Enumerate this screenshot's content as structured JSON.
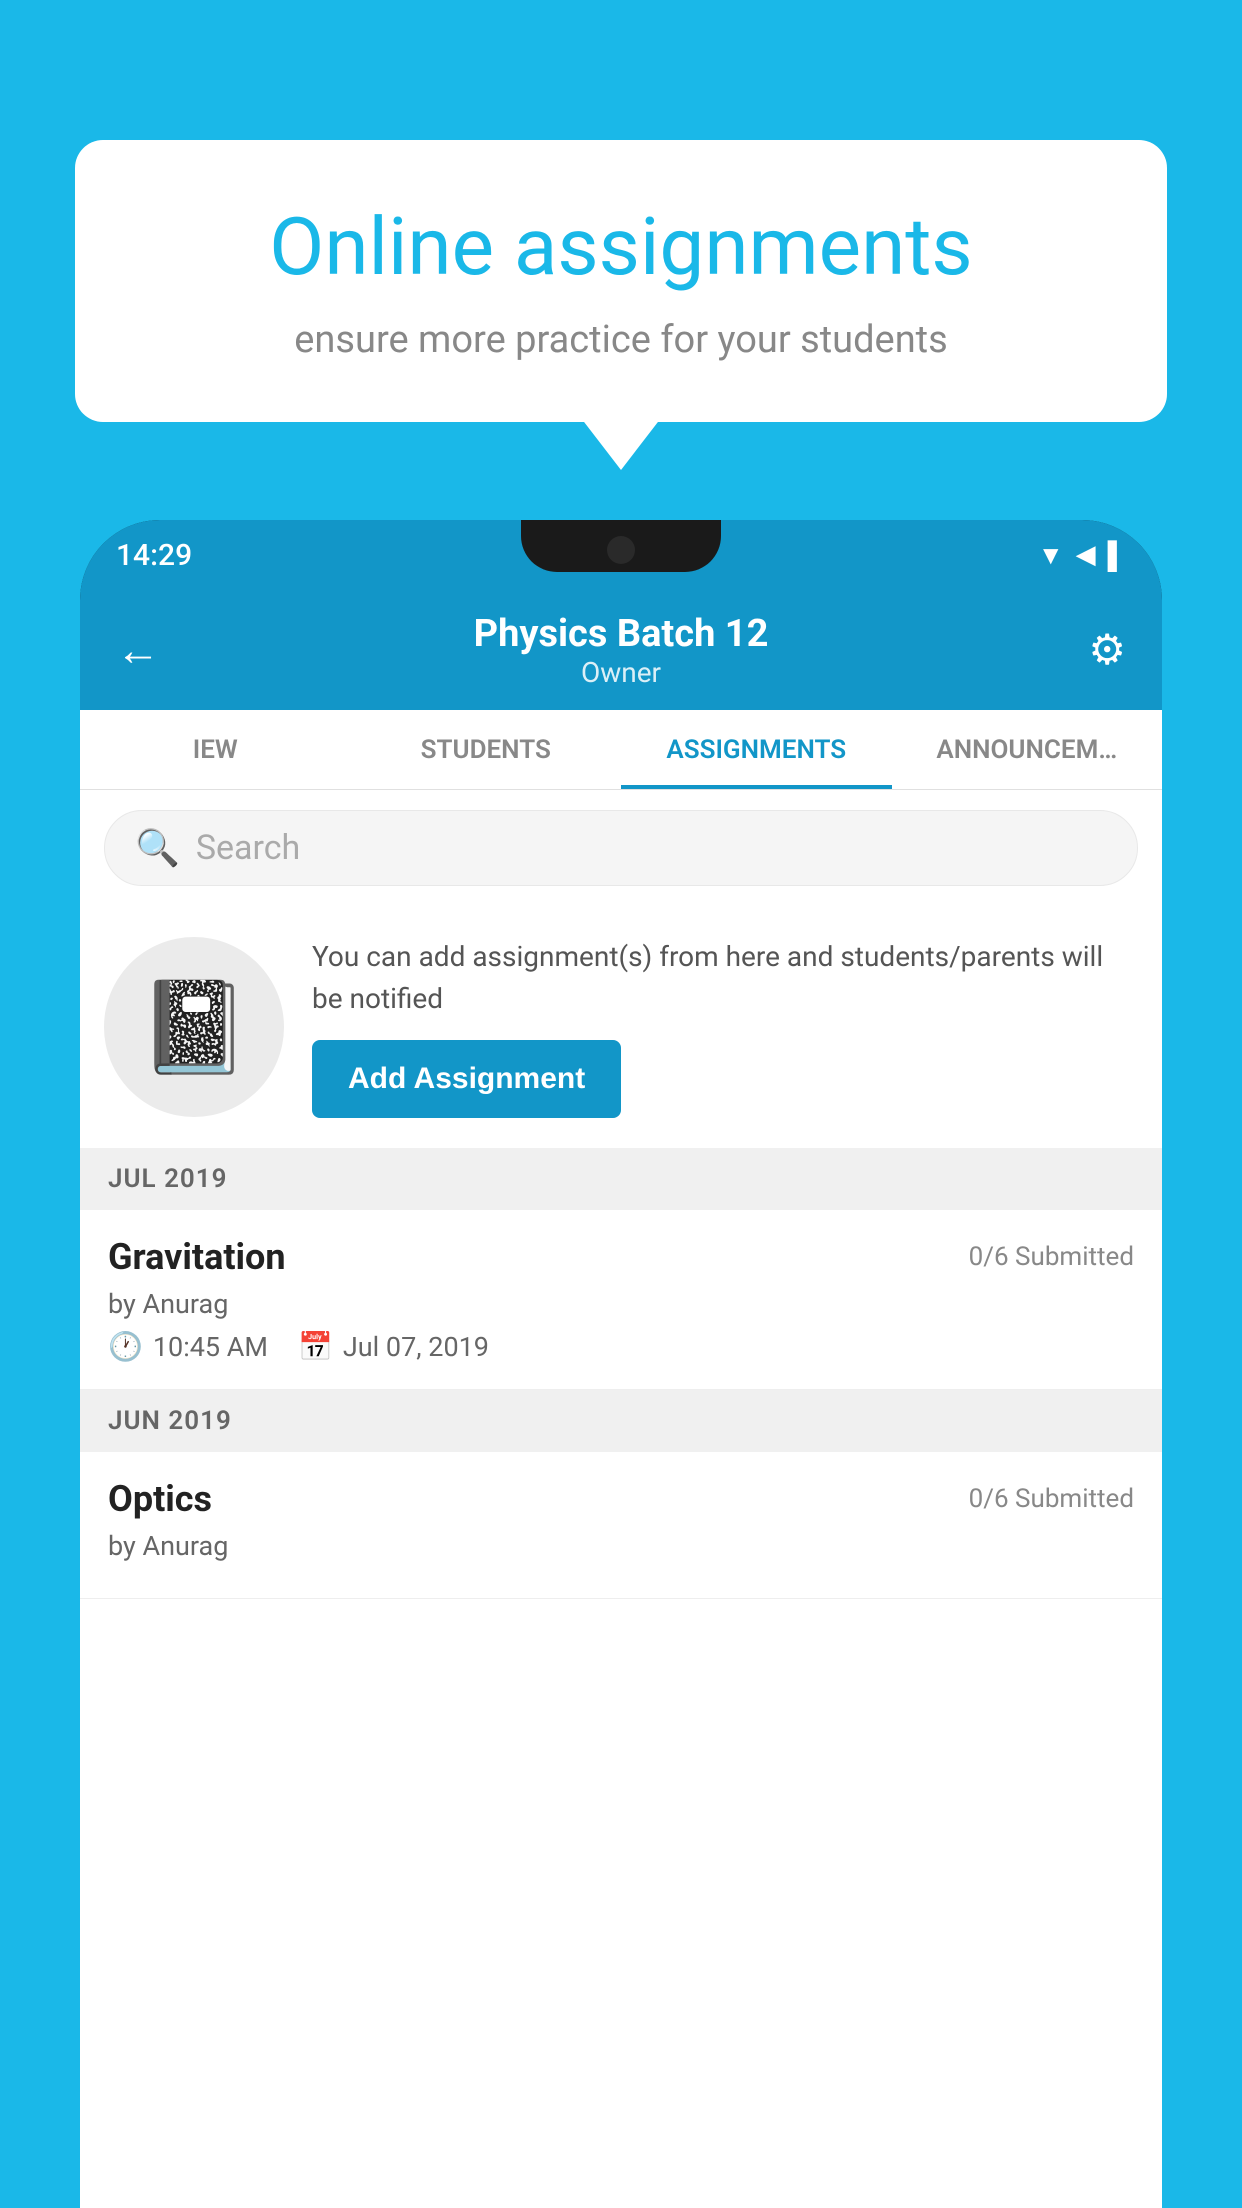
{
  "background_color": "#1ab8e8",
  "speech_bubble": {
    "title": "Online assignments",
    "subtitle": "ensure more practice for your students"
  },
  "status_bar": {
    "time": "14:29",
    "icons": [
      "wifi",
      "signal",
      "battery"
    ]
  },
  "app_header": {
    "title": "Physics Batch 12",
    "subtitle": "Owner",
    "back_icon": "←",
    "settings_icon": "⚙"
  },
  "tabs": [
    {
      "label": "IEW",
      "active": false
    },
    {
      "label": "STUDENTS",
      "active": false
    },
    {
      "label": "ASSIGNMENTS",
      "active": true
    },
    {
      "label": "ANNOUNCEM…",
      "active": false
    }
  ],
  "search": {
    "placeholder": "Search"
  },
  "promo": {
    "text": "You can add assignment(s) from here and students/parents will be notified",
    "button_label": "Add Assignment"
  },
  "sections": [
    {
      "label": "JUL 2019",
      "assignments": [
        {
          "title": "Gravitation",
          "submitted": "0/6 Submitted",
          "by": "by Anurag",
          "time": "10:45 AM",
          "date": "Jul 07, 2019"
        }
      ]
    },
    {
      "label": "JUN 2019",
      "assignments": [
        {
          "title": "Optics",
          "submitted": "0/6 Submitted",
          "by": "by Anurag",
          "time": "",
          "date": ""
        }
      ]
    }
  ]
}
